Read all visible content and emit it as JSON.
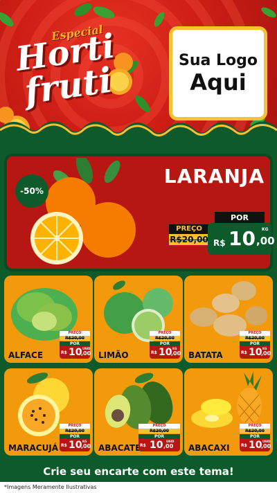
{
  "header": {
    "special": "Especial",
    "title_line1": "Horti",
    "title_line2": "fruti",
    "logo_line1": "Sua Logo",
    "logo_line2": "Aqui"
  },
  "main_offer": {
    "product": "LARANJA",
    "discount": "-50%",
    "old_label": "PREÇO",
    "old_price": "R$20,00",
    "por": "POR",
    "currency": "R$",
    "price_int": "10",
    "price_cents": ",00",
    "unit": "KG"
  },
  "items": [
    {
      "name": "ALFACE",
      "old_label": "PREÇO",
      "old_price": "R$20,00",
      "por": "POR",
      "currency": "R$",
      "price_int": "10",
      "price_cents": ",00",
      "unit": "UNID"
    },
    {
      "name": "LIMÃO",
      "old_label": "PREÇO",
      "old_price": "R$20,00",
      "por": "POR",
      "currency": "R$",
      "price_int": "10",
      "price_cents": ",00",
      "unit": "KG"
    },
    {
      "name": "BATATA",
      "old_label": "PREÇO",
      "old_price": "R$20,00",
      "por": "POR",
      "currency": "R$",
      "price_int": "10",
      "price_cents": ",00",
      "unit": "KG"
    },
    {
      "name": "MARACUJÁ",
      "old_label": "PREÇO",
      "old_price": "R$20,00",
      "por": "POR",
      "currency": "R$",
      "price_int": "10",
      "price_cents": ",00",
      "unit": "KG"
    },
    {
      "name": "ABACATE",
      "old_label": "PREÇO",
      "old_price": "R$20,00",
      "por": "POR",
      "currency": "R$",
      "price_int": "10",
      "price_cents": ",00",
      "unit": "UNID"
    },
    {
      "name": "ABACAXI",
      "old_label": "PREÇO",
      "old_price": "R$20,00",
      "por": "POR",
      "currency": "R$",
      "price_int": "10",
      "price_cents": ",00",
      "unit": "UNID"
    }
  ],
  "cta": "Crie seu encarte com este tema!",
  "footer": "*Imagens Meramente Ilustrativas",
  "colors": {
    "red": "#cf1f16",
    "green": "#0f5a2a",
    "orange": "#f29a0c",
    "yellow": "#f6c233"
  }
}
